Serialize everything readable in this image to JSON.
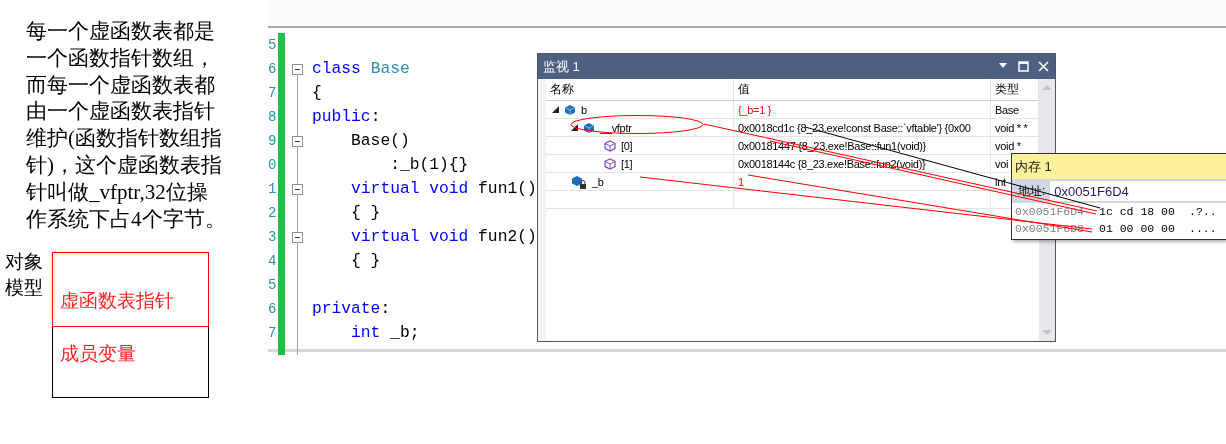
{
  "note": {
    "text": "每一个虚函数表都是一个函数指针数组，而每一个虚函数表都由一个虚函数表指针维护(函数指针数组指针)，这个虚函数表指针叫做_vfptr,32位操作系统下占4个字节。"
  },
  "object_model": {
    "label": "对象模型",
    "slots": [
      {
        "text": "虚函数表指针",
        "color": "#ff0000"
      },
      {
        "text": "成员变量",
        "color": "#000000"
      }
    ]
  },
  "code_editor": {
    "lines": [
      {
        "number": "5"
      },
      {
        "number": "6",
        "expanded": true,
        "tokens": [
          {
            "kind": "keyword",
            "text": "class "
          },
          {
            "kind": "type",
            "text": "Base"
          }
        ]
      },
      {
        "number": "7",
        "tokens": [
          {
            "kind": "plain",
            "text": "{"
          }
        ]
      },
      {
        "number": "8",
        "tokens": [
          {
            "kind": "keyword",
            "text": "public"
          },
          {
            "kind": "plain",
            "text": ":"
          }
        ]
      },
      {
        "number": "9",
        "expanded": true,
        "tokens": [
          {
            "kind": "plain",
            "text": "    Base()"
          }
        ]
      },
      {
        "number": "0",
        "tokens": [
          {
            "kind": "plain",
            "text": "        :_b(1){}"
          }
        ]
      },
      {
        "number": "1",
        "expanded": true,
        "tokens": [
          {
            "kind": "keyword",
            "text": "    virtual void"
          },
          {
            "kind": "plain",
            "text": " fun1()"
          }
        ]
      },
      {
        "number": "2",
        "tokens": [
          {
            "kind": "plain",
            "text": "    { }"
          }
        ]
      },
      {
        "number": "3",
        "expanded": true,
        "tokens": [
          {
            "kind": "keyword",
            "text": "    virtual void"
          },
          {
            "kind": "plain",
            "text": " fun2()"
          }
        ]
      },
      {
        "number": "4",
        "tokens": [
          {
            "kind": "plain",
            "text": "    { }"
          }
        ]
      },
      {
        "number": "5"
      },
      {
        "number": "6",
        "tokens": [
          {
            "kind": "keyword",
            "text": "private"
          },
          {
            "kind": "plain",
            "text": ":"
          }
        ]
      },
      {
        "number": "7",
        "tokens": [
          {
            "kind": "keyword",
            "text": "    int"
          },
          {
            "kind": "plain",
            "text": " _b;"
          }
        ]
      }
    ]
  },
  "watch_window": {
    "title": "监视 1",
    "columns": [
      "名称",
      "值",
      "类型"
    ],
    "rows": [
      {
        "name": "b",
        "kind": "object",
        "value": "{_b=1 }",
        "value_changed": true,
        "type": "Base",
        "expanded": true,
        "children": [
          {
            "name": "__vfptr",
            "kind": "object",
            "value": "0x0018cd1c {8_23.exe!const Base::`vftable'} {0x00",
            "value_changed": false,
            "type": "void * *",
            "expanded": true,
            "children": [
              {
                "name": "[0]",
                "kind": "function",
                "value": "0x00181447 {8_23.exe!Base::fun1(void)}",
                "value_changed": false,
                "type": "void *"
              },
              {
                "name": "[1]",
                "kind": "function",
                "value": "0x0018144c {8_23.exe!Base::fun2(void)}",
                "value_changed": false,
                "type": "voi"
              }
            ]
          },
          {
            "name": "_b",
            "kind": "private",
            "value": "1",
            "value_changed": true,
            "type": "int"
          }
        ]
      }
    ]
  },
  "memory_window": {
    "title": "内存 1",
    "address_label": "地址:",
    "address": "0x0051F6D4",
    "rows": [
      {
        "address": "0x0051F6D4",
        "bytes": "1c cd 18 00",
        "chars": ".?.."
      },
      {
        "address": "0x0051F6D8",
        "bytes": "01 00 00 00",
        "chars": "...."
      }
    ]
  }
}
